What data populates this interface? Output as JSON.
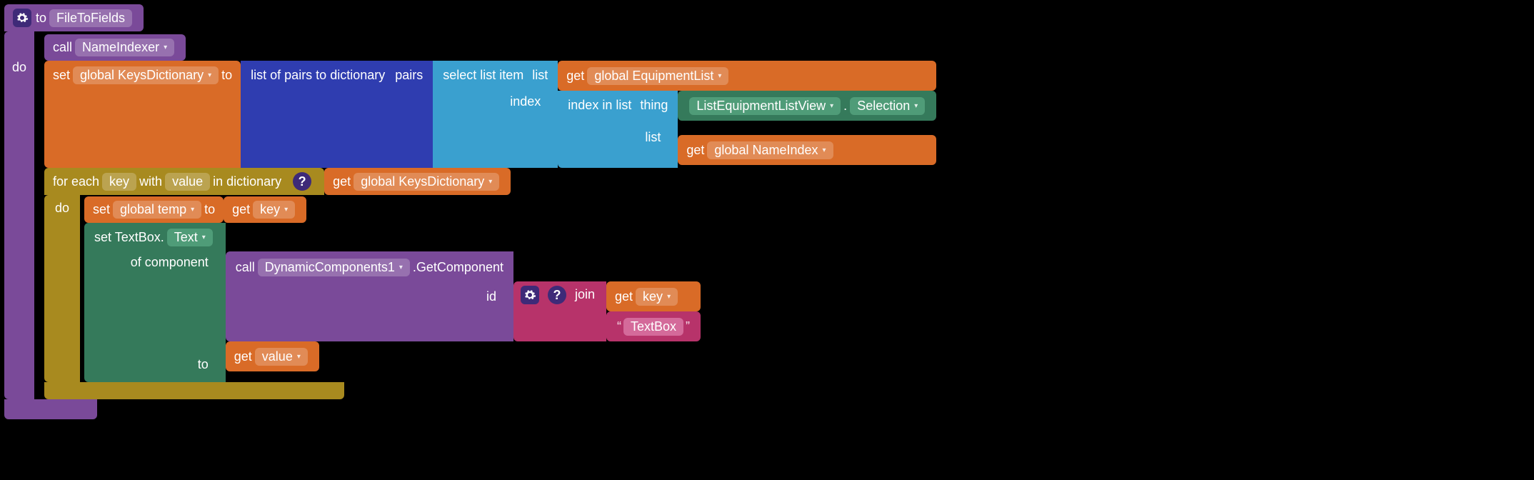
{
  "procedure": {
    "to": "to",
    "name": "FileToFields",
    "do": "do"
  },
  "call_nameindexer": {
    "call": "call",
    "proc": "NameIndexer"
  },
  "set_keysdict": {
    "set": "set",
    "var": "global KeysDictionary",
    "to": "to"
  },
  "list_pairs": {
    "label": "list of pairs to dictionary",
    "arg": "pairs"
  },
  "select_list": {
    "label": "select list item",
    "list": "list",
    "index": "index"
  },
  "get_equip": {
    "get": "get",
    "var": "global EquipmentList"
  },
  "index_in_list": {
    "label": "index in list",
    "thing": "thing",
    "list": "list"
  },
  "component_prop": {
    "component": "ListEquipmentListView",
    "dot": ".",
    "prop": "Selection"
  },
  "get_nameindex": {
    "get": "get",
    "var": "global NameIndex"
  },
  "foreach": {
    "label1": "for each",
    "keyvar": "key",
    "with": "with",
    "valvar": "value",
    "label2": "in dictionary",
    "do": "do"
  },
  "get_keysdict": {
    "get": "get",
    "var": "global KeysDictionary"
  },
  "set_temp": {
    "set": "set",
    "var": "global temp",
    "to": "to"
  },
  "get_key": {
    "get": "get",
    "var": "key"
  },
  "set_textbox": {
    "label": "set TextBox.",
    "prop": "Text",
    "of": "of component",
    "to": "to"
  },
  "call_dyn": {
    "call": "call",
    "comp": "DynamicComponents1",
    "method": ".GetComponent",
    "id": "id"
  },
  "join": {
    "label": "join"
  },
  "get_key2": {
    "get": "get",
    "var": "key"
  },
  "text_literal": "TextBox",
  "get_value": {
    "get": "get",
    "var": "value"
  }
}
